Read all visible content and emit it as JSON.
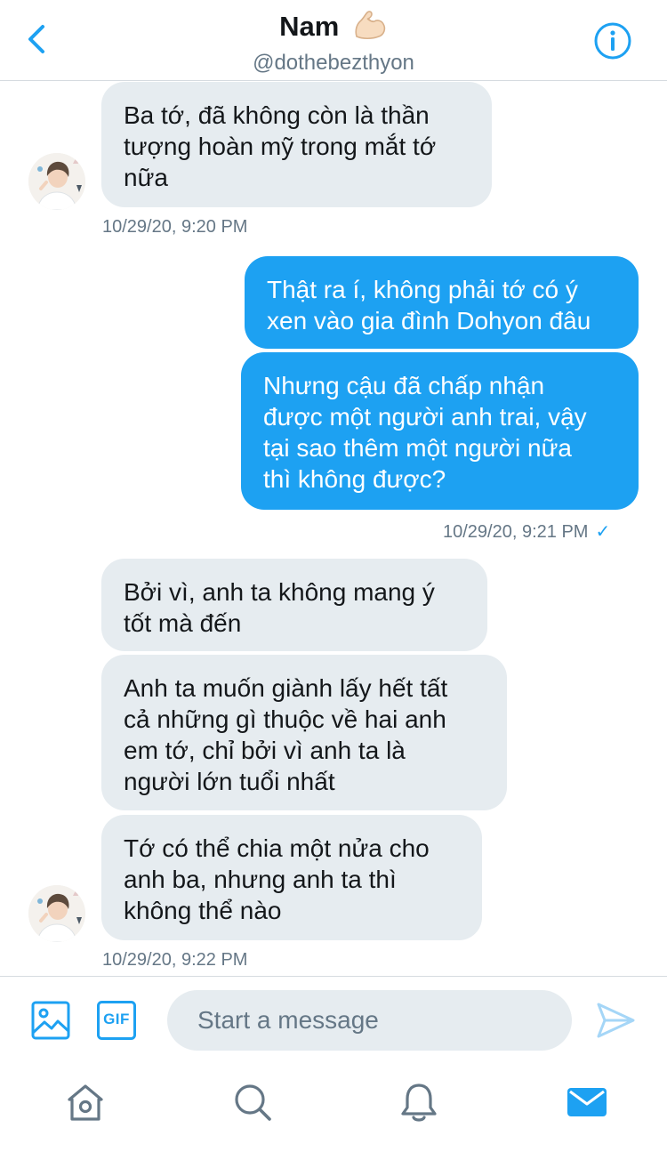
{
  "header": {
    "name": "Nam",
    "handle": "@dothebezthyon"
  },
  "icons": {
    "back": "chevron-left-icon",
    "info": "info-icon",
    "emoji": "flexed-biceps-emoji",
    "image": "image-icon",
    "gif": "gif-icon",
    "send": "send-icon",
    "home": "home-icon",
    "search": "search-icon",
    "notifications": "bell-icon",
    "messages": "mail-icon"
  },
  "colors": {
    "accent": "#1da1f2",
    "incoming_bubble": "#e6ecf0",
    "timestamp": "#657786"
  },
  "messages": [
    {
      "direction": "in",
      "text": "Ba tớ, đã không còn là thần\ntượng hoàn mỹ trong mắt tớ\nnữa"
    },
    {
      "direction": "out",
      "text": "Thật ra í, không phải tớ có ý\nxen vào gia đình Dohyon đâu"
    },
    {
      "direction": "out",
      "text": "Nhưng cậu đã chấp nhận\nđược một người anh trai, vậy\ntại sao thêm một người nữa\nthì không được?"
    },
    {
      "direction": "in",
      "text": "Bởi vì, anh ta không mang ý\ntốt mà đến"
    },
    {
      "direction": "in",
      "text": "Anh ta muốn giành lấy hết tất\ncả những gì thuộc về hai anh\nem tớ, chỉ bởi vì anh ta là\nngười lớn tuổi nhất"
    },
    {
      "direction": "in",
      "text": "Tớ có thể chia một nửa cho\nanh ba, nhưng anh ta thì\nkhông thể nào"
    }
  ],
  "timestamps": [
    {
      "text": "10/29/20, 9:20 PM"
    },
    {
      "text": "10/29/20, 9:21 PM",
      "read_mark": "✓"
    },
    {
      "text": "10/29/20, 9:22 PM"
    }
  ],
  "composer": {
    "gif_label": "GIF",
    "placeholder": "Start a message",
    "value": ""
  },
  "tabbar": {
    "active": "messages"
  }
}
